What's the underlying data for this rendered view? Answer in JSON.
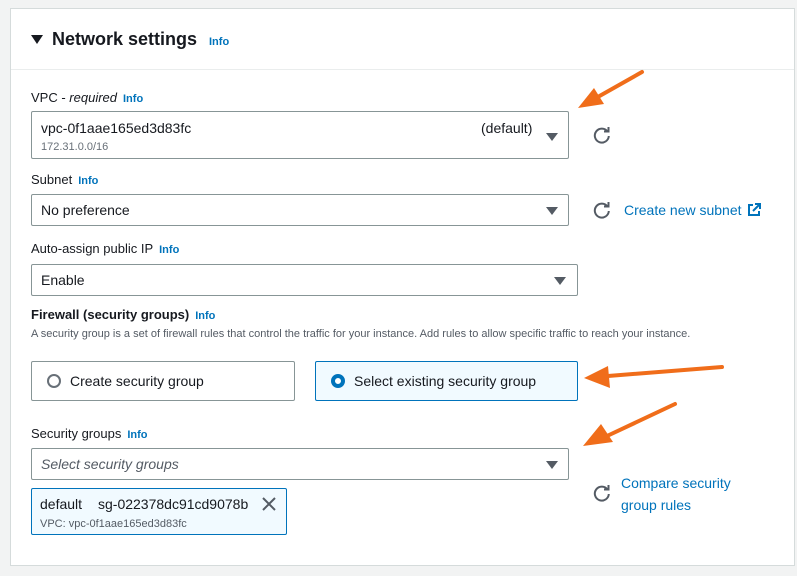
{
  "section": {
    "title": "Network settings",
    "info": "Info"
  },
  "vpc": {
    "label": "VPC - ",
    "label_italic": "required",
    "info": "Info",
    "value": "vpc-0f1aae165ed3d83fc",
    "tag": "(default)",
    "cidr": "172.31.0.0/16"
  },
  "subnet": {
    "label": "Subnet",
    "info": "Info",
    "value": "No preference",
    "create_link": "Create new subnet"
  },
  "public_ip": {
    "label": "Auto-assign public IP",
    "info": "Info",
    "value": "Enable"
  },
  "firewall": {
    "label": "Firewall (security groups)",
    "info": "Info",
    "description": "A security group is a set of firewall rules that control the traffic for your instance. Add rules to allow specific traffic to reach your instance.",
    "option_create": "Create security group",
    "option_existing": "Select existing security group",
    "selected": "existing"
  },
  "security_groups": {
    "label": "Security groups",
    "info": "Info",
    "placeholder": "Select security groups",
    "compare_link_line1": "Compare security",
    "compare_link_line2": "group rules",
    "token_name": "default",
    "token_id": "sg-022378dc91cd9078b",
    "token_vpc": "VPC: vpc-0f1aae165ed3d83fc"
  },
  "colors": {
    "accent": "#0073bb",
    "arrow": "#f06d1a"
  }
}
